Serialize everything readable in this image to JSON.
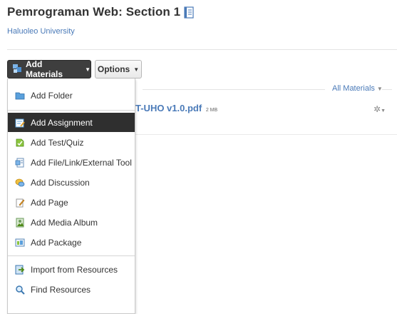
{
  "header": {
    "title": "Pemrograman Web: Section 1",
    "subtitle": "Haluoleo University"
  },
  "toolbar": {
    "add_materials_label": "Add Materials",
    "options_label": "Options"
  },
  "filter": {
    "all_materials_label": "All Materials"
  },
  "material": {
    "file_name_visible": "T-UHO v1.0.pdf",
    "file_size": "2 MB"
  },
  "menu": {
    "items": [
      {
        "label": "Add Folder",
        "icon": "folder-icon"
      },
      {
        "label": "Add Assignment",
        "icon": "assignment-icon",
        "active": true
      },
      {
        "label": "Add Test/Quiz",
        "icon": "test-quiz-icon"
      },
      {
        "label": "Add File/Link/External Tool",
        "icon": "file-link-icon"
      },
      {
        "label": "Add Discussion",
        "icon": "discussion-icon"
      },
      {
        "label": "Add Page",
        "icon": "page-icon"
      },
      {
        "label": "Add Media Album",
        "icon": "media-album-icon"
      },
      {
        "label": "Add Package",
        "icon": "package-icon"
      },
      {
        "label": "Import from Resources",
        "icon": "import-icon"
      },
      {
        "label": "Find Resources",
        "icon": "find-icon"
      }
    ]
  },
  "colors": {
    "link": "#4a7ab8",
    "dark_button": "#3e3e3e",
    "active_menu": "#2f2f2f"
  }
}
